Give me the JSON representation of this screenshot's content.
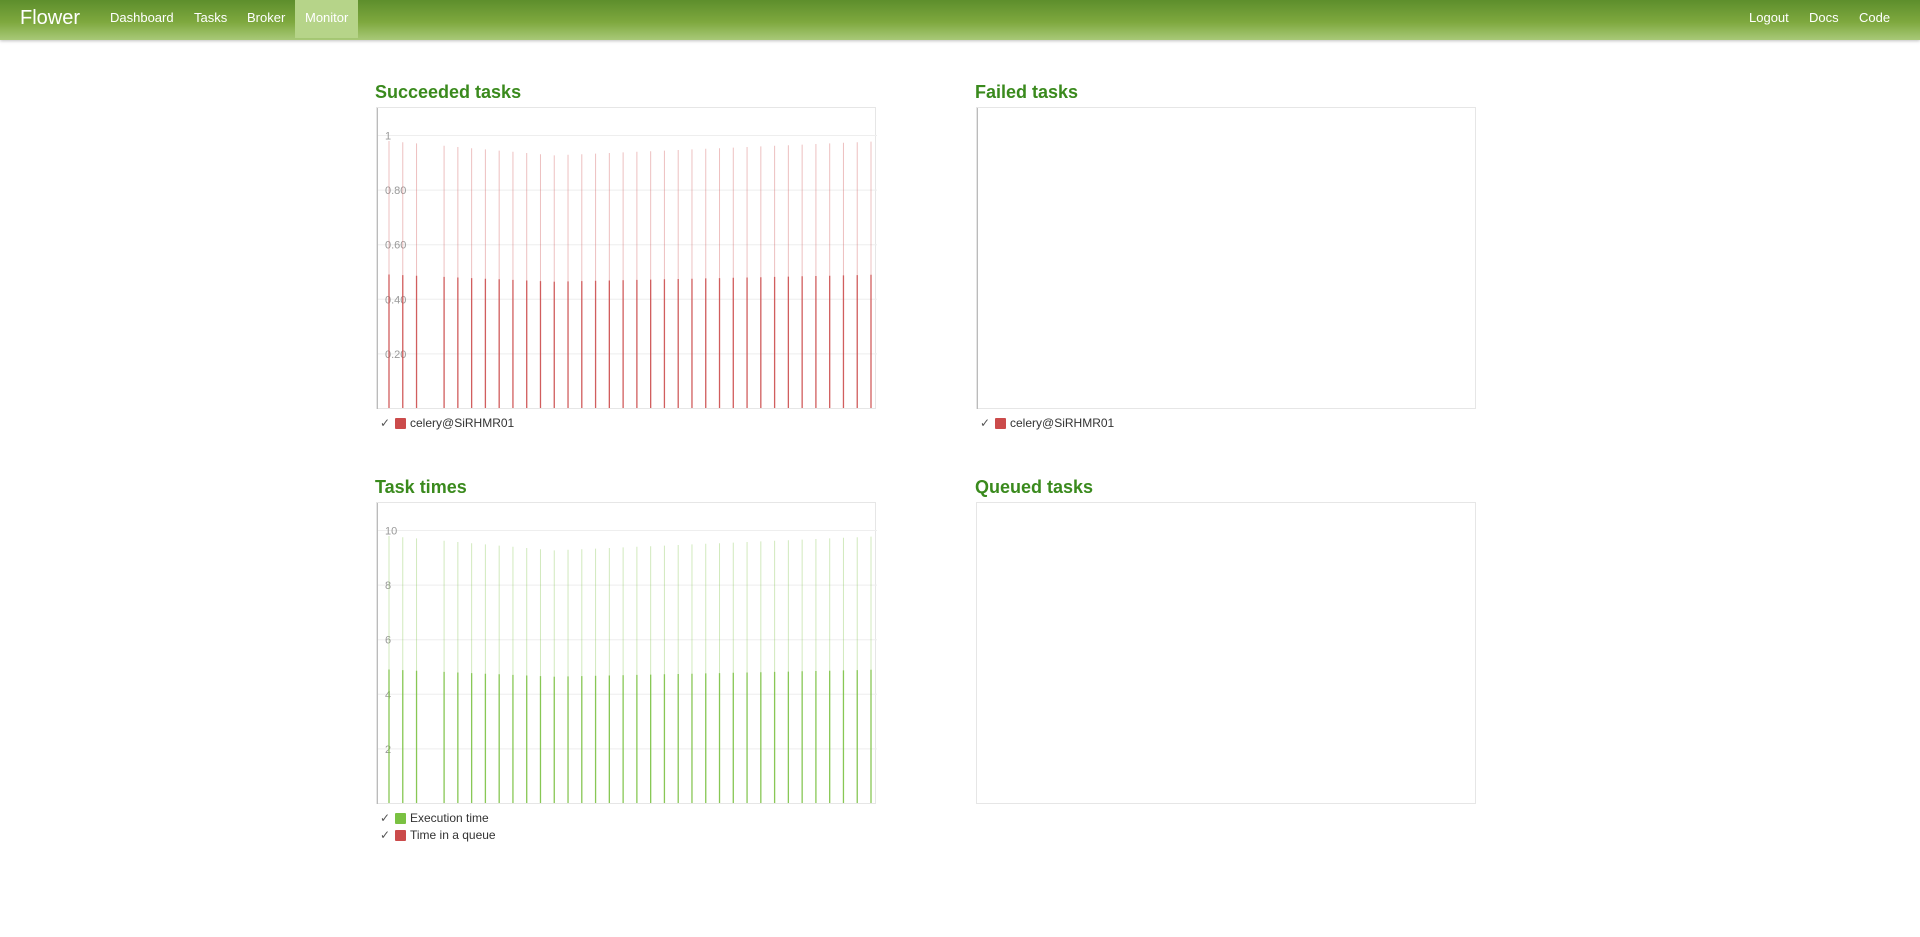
{
  "nav": {
    "brand": "Flower",
    "items": [
      {
        "label": "Dashboard",
        "active": false
      },
      {
        "label": "Tasks",
        "active": false
      },
      {
        "label": "Broker",
        "active": false
      },
      {
        "label": "Monitor",
        "active": true
      }
    ],
    "right": [
      {
        "label": "Logout"
      },
      {
        "label": "Docs"
      },
      {
        "label": "Code"
      }
    ]
  },
  "panels": {
    "succeeded": {
      "title": "Succeeded tasks",
      "legend": [
        {
          "label": "celery@SiRHMR01",
          "color": "#cb4b4b",
          "checked": true
        }
      ]
    },
    "failed": {
      "title": "Failed tasks",
      "legend": [
        {
          "label": "celery@SiRHMR01",
          "color": "#cb4b4b",
          "checked": true
        }
      ]
    },
    "times": {
      "title": "Task times",
      "legend": [
        {
          "label": "Execution time",
          "color": "#7ac142",
          "checked": true
        },
        {
          "label": "Time in a queue",
          "color": "#cb4b4b",
          "checked": true
        }
      ]
    },
    "queued": {
      "title": "Queued tasks"
    }
  },
  "chart_data": [
    {
      "id": "succeeded",
      "type": "bar",
      "series_color": "#cb4b4b",
      "ylim": [
        0,
        1
      ],
      "yticks": [
        0.2,
        0.4,
        0.6,
        0.8,
        1
      ],
      "ytick_labels": [
        "0.20",
        "0.40",
        "0.60",
        "0.80",
        "1"
      ],
      "bar_count": 36,
      "values": [
        1,
        1,
        1,
        0,
        1,
        1,
        1,
        1,
        1,
        1,
        1,
        1,
        1,
        1,
        1,
        1,
        1,
        1,
        1,
        1,
        1,
        1,
        1,
        1,
        1,
        1,
        1,
        1,
        1,
        1,
        1,
        1,
        1,
        1,
        1,
        1
      ],
      "grid": true
    },
    {
      "id": "failed",
      "type": "bar",
      "series_color": "#cb4b4b",
      "values": [],
      "grid": false
    },
    {
      "id": "times",
      "type": "bar",
      "series_color": "#7ac142",
      "ylim": [
        0,
        10
      ],
      "yticks": [
        2,
        4,
        6,
        8,
        10
      ],
      "ytick_labels": [
        "2",
        "4",
        "6",
        "8",
        "10"
      ],
      "bar_count": 36,
      "values": [
        10,
        10,
        10,
        0,
        10,
        10,
        10,
        10,
        10,
        10,
        10,
        10,
        10,
        10,
        10,
        10,
        10,
        10,
        10,
        10,
        10,
        10,
        10,
        10,
        10,
        10,
        10,
        10,
        10,
        10,
        10,
        10,
        10,
        10,
        10,
        10
      ],
      "grid": true
    },
    {
      "id": "queued",
      "type": "bar",
      "values": [],
      "grid": false
    }
  ]
}
